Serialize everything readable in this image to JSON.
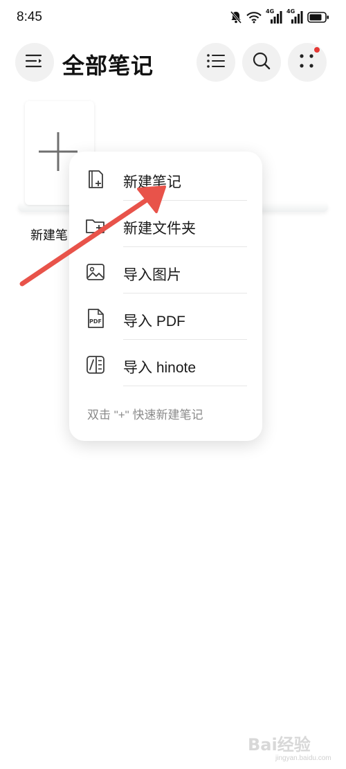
{
  "status_bar": {
    "time": "8:45",
    "icons": [
      "bell-mute-icon",
      "wifi-icon",
      "signal-4g-1-icon",
      "signal-4g-2-icon",
      "battery-icon"
    ],
    "network_labels": [
      "4G",
      "4G"
    ]
  },
  "header": {
    "title": "全部笔记",
    "menu_icon": "sidebar-menu-icon",
    "actions": [
      "list-view-icon",
      "search-icon",
      "more-dots-icon"
    ],
    "notification_dot_color": "#e53935"
  },
  "new_note_tile": {
    "label": "新建笔",
    "icon": "plus-icon"
  },
  "popup_menu": {
    "items": [
      {
        "label": "新建笔记",
        "icon": "new-note-icon"
      },
      {
        "label": "新建文件夹",
        "icon": "new-folder-icon"
      },
      {
        "label": "导入图片",
        "icon": "image-icon"
      },
      {
        "label": "导入 PDF",
        "icon": "pdf-file-icon",
        "icon_text": "PDF"
      },
      {
        "label": "导入 hinote",
        "icon": "hinote-icon"
      }
    ],
    "hint": "双击 \"+\" 快速新建笔记"
  },
  "annotation": {
    "arrow_color": "#e8534a"
  },
  "watermark": {
    "brand": "Bai经验",
    "sub": "jingyan.baidu.com"
  }
}
